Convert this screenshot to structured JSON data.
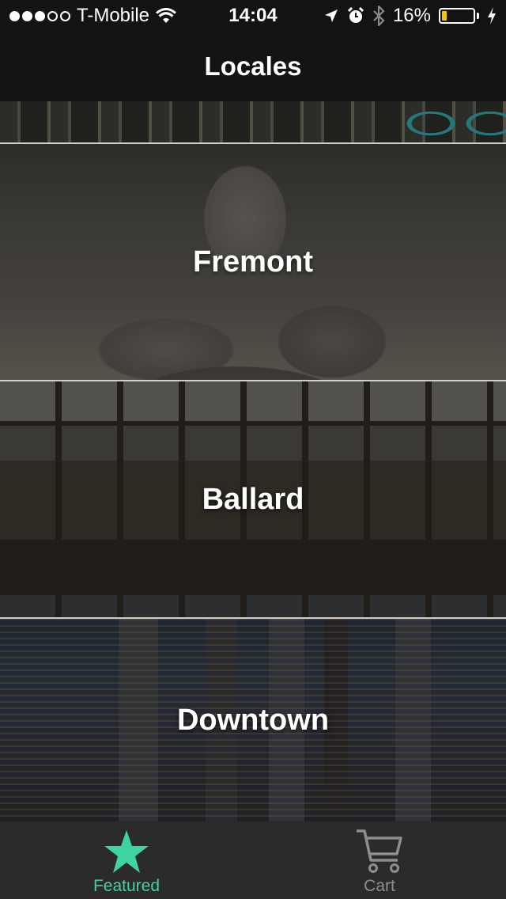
{
  "status_bar": {
    "signal_filled": 3,
    "signal_total": 5,
    "carrier": "T-Mobile",
    "wifi_icon": "wifi-icon",
    "time": "14:04",
    "location_icon": "location-arrow-icon",
    "alarm_icon": "alarm-icon",
    "bluetooth_icon": "bluetooth-icon",
    "battery_percent": "16%",
    "battery_level": 0.16,
    "battery_color": "#f5c400",
    "charging_icon": "charging-bolt-icon"
  },
  "nav": {
    "title": "Locales"
  },
  "locales": [
    {
      "label": ""
    },
    {
      "label": "Fremont"
    },
    {
      "label": "Ballard"
    },
    {
      "label": "Downtown"
    }
  ],
  "tabs": [
    {
      "label": "Featured",
      "icon": "star-icon",
      "active": true,
      "color": "#3fd3a3"
    },
    {
      "label": "Cart",
      "icon": "cart-icon",
      "active": false,
      "color": "#8e8e8e"
    }
  ]
}
